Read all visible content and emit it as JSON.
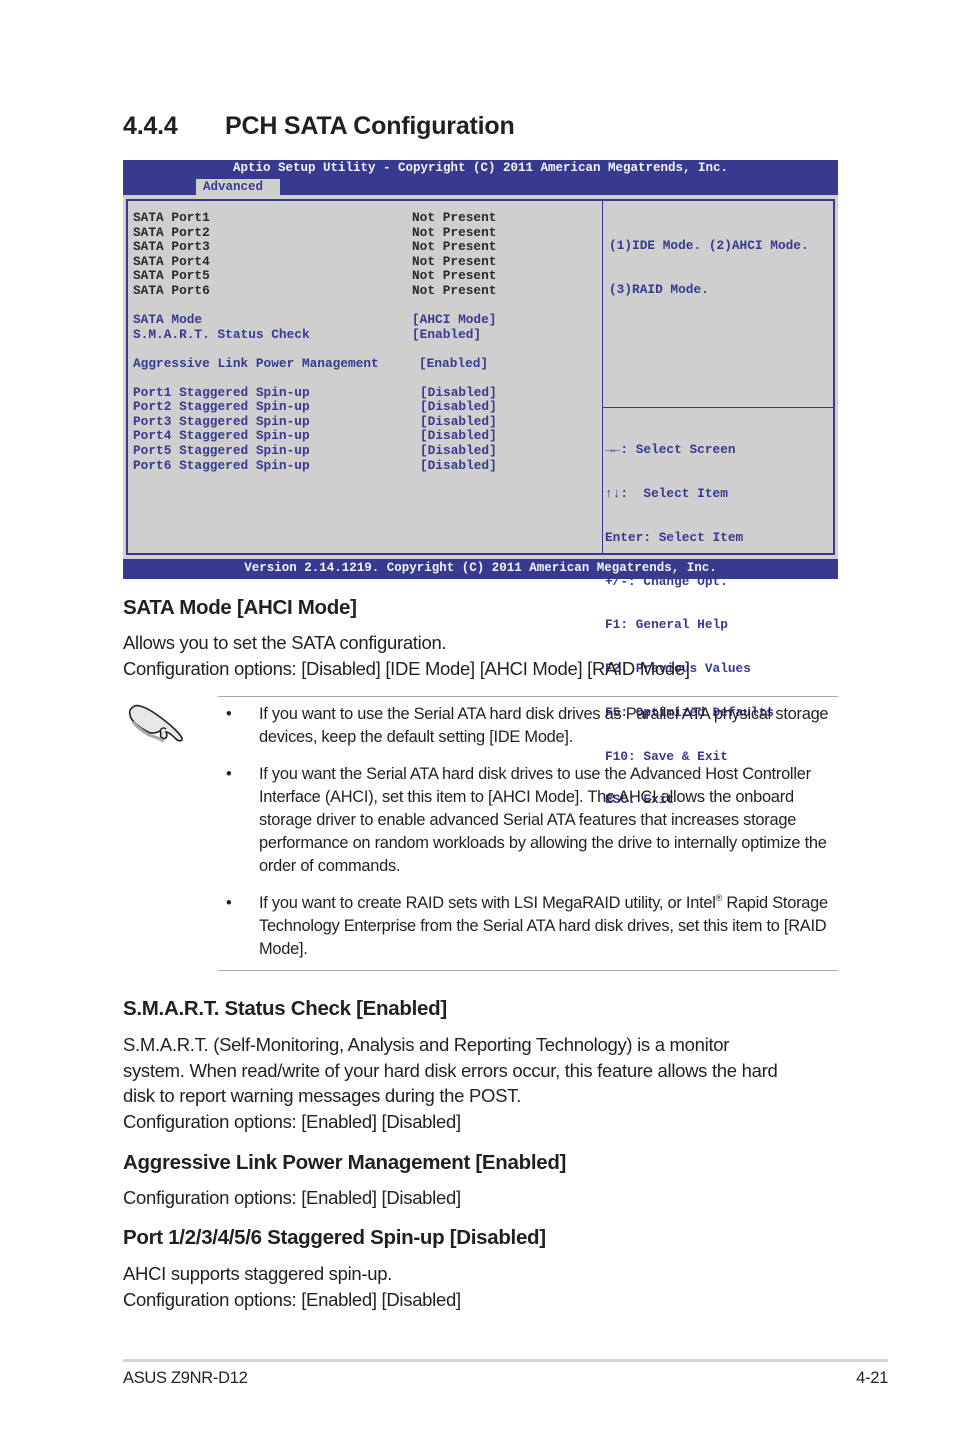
{
  "section": {
    "number": "4.4.4",
    "title": "PCH SATA Configuration"
  },
  "bios": {
    "title": "Aptio Setup Utility - Copyright (C) 2011 American Megatrends, Inc.",
    "active_tab": "Advanced",
    "status_rows": [
      {
        "label": "SATA Port1",
        "value": "Not Present"
      },
      {
        "label": "SATA Port2",
        "value": "Not Present"
      },
      {
        "label": "SATA Port3",
        "value": "Not Present"
      },
      {
        "label": "SATA Port4",
        "value": "Not Present"
      },
      {
        "label": "SATA Port5",
        "value": "Not Present"
      },
      {
        "label": "SATA Port6",
        "value": "Not Present"
      }
    ],
    "settings": [
      {
        "label": "SATA Mode",
        "value": "[AHCI Mode]"
      },
      {
        "label": "S.M.A.R.T. Status Check",
        "value": "[Enabled]"
      },
      {
        "label": "Aggressive Link Power Management",
        "value": "[Enabled]"
      }
    ],
    "spinup_rows": [
      {
        "label": "Port1 Staggered Spin-up",
        "value": "[Disabled]"
      },
      {
        "label": "Port2 Staggered Spin-up",
        "value": "[Disabled]"
      },
      {
        "label": "Port3 Staggered Spin-up",
        "value": "[Disabled]"
      },
      {
        "label": "Port4 Staggered Spin-up",
        "value": "[Disabled]"
      },
      {
        "label": "Port5 Staggered Spin-up",
        "value": "[Disabled]"
      },
      {
        "label": "Port6 Staggered Spin-up",
        "value": "[Disabled]"
      }
    ],
    "help_text": [
      "(1)IDE Mode. (2)AHCI Mode.",
      "(3)RAID Mode."
    ],
    "key_help": [
      "→←: Select Screen",
      "↑↓:  Select Item",
      "Enter: Select Item",
      "+/-: Change Opt.",
      "F1: General Help",
      "F2: Previous Values",
      "F5: Optimized Defaults",
      "F10: Save & Exit",
      "ESC: Exit"
    ],
    "version": "Version 2.14.1219. Copyright (C) 2011 American Megatrends, Inc."
  },
  "sata_mode": {
    "heading": "SATA Mode [AHCI Mode]",
    "lines": [
      "Allows you to set the SATA configuration.",
      "Configuration options: [Disabled] [IDE Mode] [AHCI Mode] [RAID Mode]"
    ]
  },
  "note": {
    "icon": "pointing-hand-icon",
    "bullet": "•",
    "items": [
      "If you want to use the Serial ATA hard disk drives as Parallel ATA physical storage devices, keep the default setting [IDE Mode].",
      "If you want the Serial ATA hard disk drives to use the Advanced Host Controller Interface (AHCI), set this item to [AHCI Mode]. The AHCI allows the onboard storage driver to enable advanced Serial ATA features that increases storage performance on random workloads by allowing the drive to internally optimize the order of commands."
    ],
    "raid_item": {
      "before": "If you want to create RAID sets with LSI MegaRAID utility, or Intel",
      "sup": "®",
      "after": " Rapid Storage Technology Enterprise from the Serial ATA hard disk drives, set this item to [RAID Mode]."
    }
  },
  "smart": {
    "heading": "S.M.A.R.T. Status Check [Enabled]",
    "lines": [
      "S.M.A.R.T. (Self-Monitoring, Analysis and Reporting Technology) is a monitor",
      "system. When read/write of your hard disk errors occur, this feature allows the hard",
      "disk to report warning messages during the POST.",
      "Configuration options: [Enabled] [Disabled]"
    ]
  },
  "alpm": {
    "heading": "Aggressive Link Power Management [Enabled]",
    "lines": [
      "Configuration options: [Enabled] [Disabled]"
    ]
  },
  "spinup": {
    "heading": "Port 1/2/3/4/5/6 Staggered Spin-up [Disabled]",
    "lines": [
      "AHCI supports staggered spin-up.",
      "Configuration options: [Enabled] [Disabled]"
    ]
  },
  "footer": {
    "product": "ASUS Z9NR-D12",
    "page": "4-21"
  }
}
